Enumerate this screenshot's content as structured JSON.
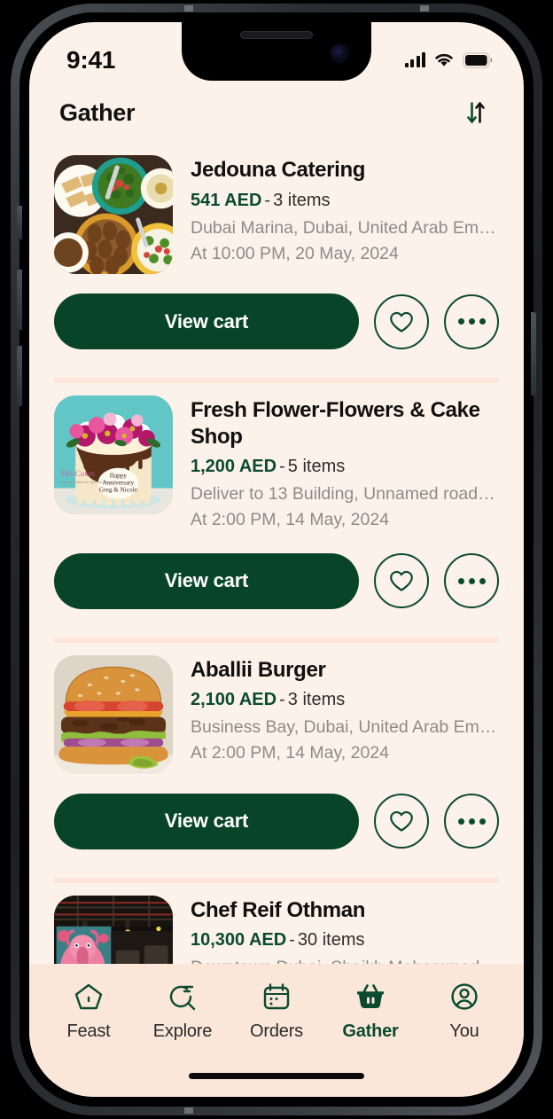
{
  "status_bar": {
    "time": "9:41",
    "cellular_icon": "signal-bars-icon",
    "wifi_icon": "wifi-icon",
    "battery_icon": "battery-full-icon"
  },
  "header": {
    "title": "Gather",
    "sort_icon": "sort-arrows-icon"
  },
  "theme": {
    "accent_green": "#0B4A2F",
    "button_green": "#074429",
    "page_bg": "#FDF2EA",
    "divider": "#FBE6D9",
    "nav_bg": "#FAE7DA",
    "muted_text": "#8d8b88"
  },
  "buttons": {
    "view_cart_label": "View cart",
    "favorite_icon": "heart-icon",
    "more_icon": "ellipsis-icon"
  },
  "carts": [
    {
      "name": "Jedouna Catering",
      "price": "541 AED",
      "separator": "-",
      "items": "3 items",
      "address": "Dubai Marina, Dubai, United Arab Emira...",
      "time": "At 10:00 PM, 20 May, 2024",
      "thumbnail": "mezze-platter-photo"
    },
    {
      "name": "Fresh Flower-Flowers & Cake Shop",
      "price": "1,200 AED",
      "separator": "-",
      "items": "5 items",
      "address": "Deliver to 13 Building, Unnamed road, D...",
      "time": "At 2:00 PM, 14 May, 2024",
      "thumbnail": "flower-cake-photo"
    },
    {
      "name": "Aballii Burger",
      "price": "2,100 AED",
      "separator": "-",
      "items": "3 items",
      "address": "Business Bay, Dubai, United Arab Emira...",
      "time": "At 2:00 PM, 14 May, 2024",
      "thumbnail": "cheeseburger-photo"
    },
    {
      "name": "Chef Reif Othman",
      "price": "10,300 AED",
      "separator": "-",
      "items": "30 items",
      "address": "Downtown Dubai. Sheikh Mohammed bi...",
      "time": "",
      "thumbnail": "restaurant-interior-photo"
    }
  ],
  "bottom_nav": [
    {
      "label": "Feast",
      "icon": "home-pentagon-icon",
      "active": false
    },
    {
      "label": "Explore",
      "icon": "search-lines-icon",
      "active": false
    },
    {
      "label": "Orders",
      "icon": "calendar-icon",
      "active": false
    },
    {
      "label": "Gather",
      "icon": "basket-filled-icon",
      "active": true
    },
    {
      "label": "You",
      "icon": "person-circle-icon",
      "active": false
    }
  ]
}
